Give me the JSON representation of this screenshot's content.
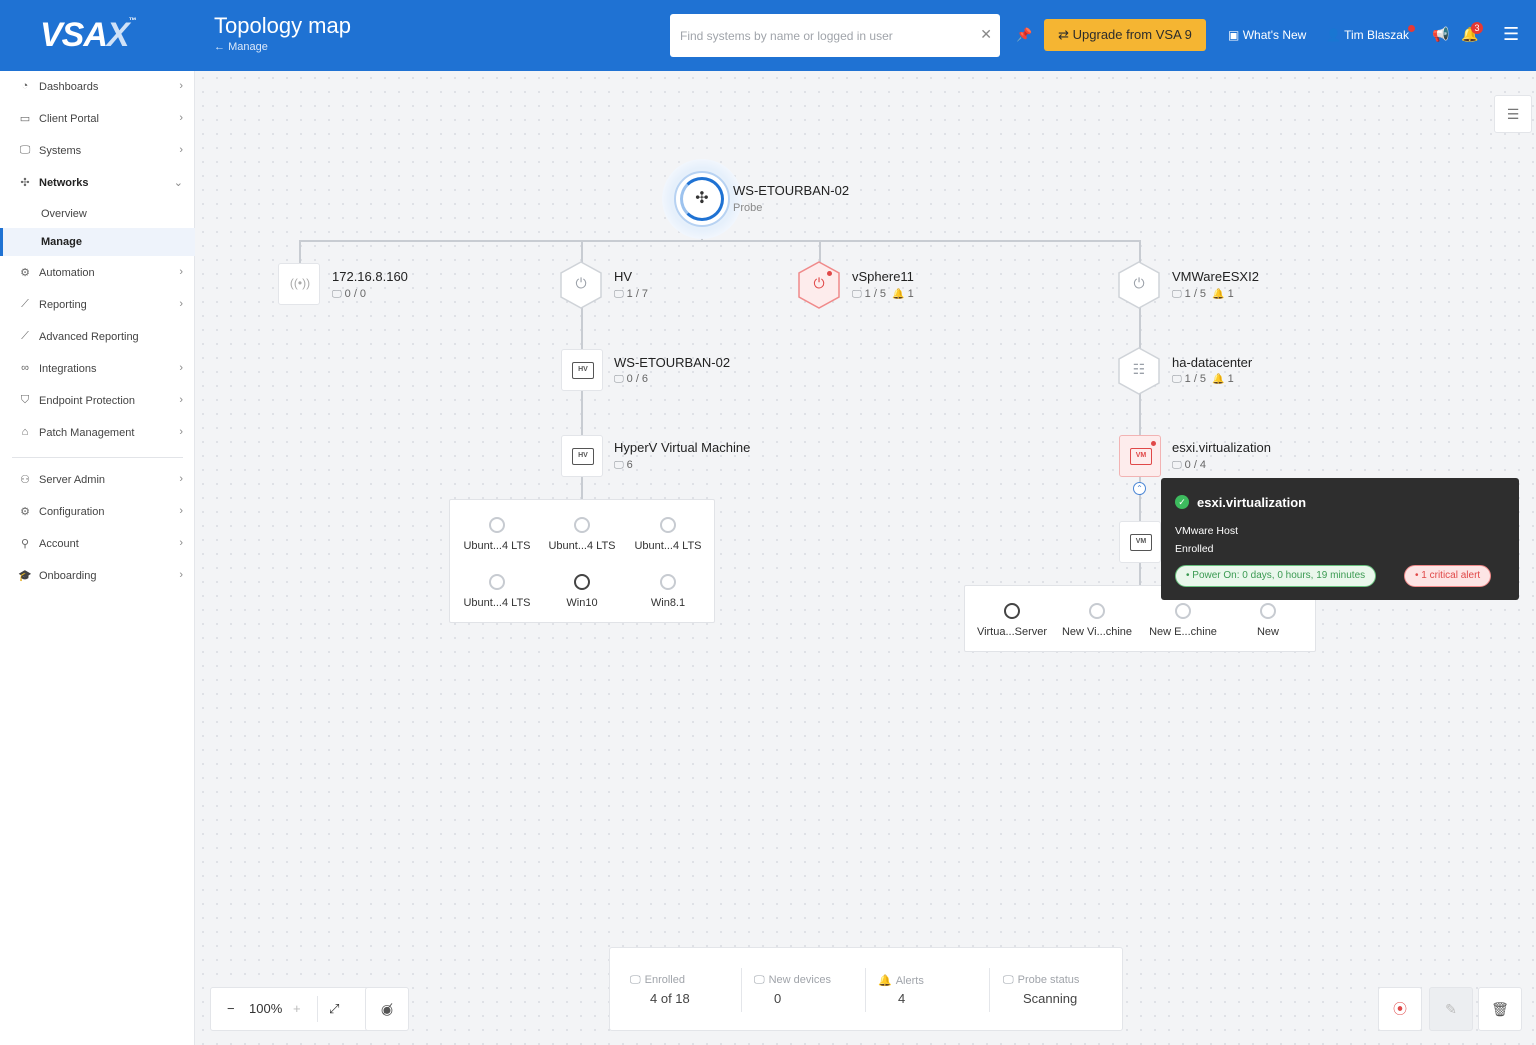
{
  "header": {
    "logo": "VSA",
    "logo_x": "X",
    "logo_tm": "™",
    "title": "Topology map",
    "breadcrumb": "Manage",
    "search_placeholder": "Find systems by name or logged in user",
    "upgrade_label": "Upgrade from VSA 9",
    "whats_new": "What's New",
    "user_name": "Tim Blaszak",
    "notifications_count": "3"
  },
  "sidebar": {
    "items": [
      {
        "label": "Dashboards"
      },
      {
        "label": "Client Portal"
      },
      {
        "label": "Systems"
      },
      {
        "label": "Networks"
      },
      {
        "label": "Automation"
      },
      {
        "label": "Reporting"
      },
      {
        "label": "Advanced Reporting"
      },
      {
        "label": "Integrations"
      },
      {
        "label": "Endpoint Protection"
      },
      {
        "label": "Patch Management"
      },
      {
        "label": "Server Admin"
      },
      {
        "label": "Configuration"
      },
      {
        "label": "Account"
      },
      {
        "label": "Onboarding"
      }
    ],
    "sub_items": [
      {
        "label": "Overview"
      },
      {
        "label": "Manage"
      }
    ]
  },
  "topology": {
    "probe": {
      "name": "WS-ETOURBAN-02",
      "role": "Probe"
    },
    "nodes": {
      "ip": {
        "name": "172.16.8.160",
        "count": "0 / 0"
      },
      "hv": {
        "name": "HV",
        "count": "1 / 7"
      },
      "vsphere": {
        "name": "vSphere11",
        "count": "1 / 5",
        "alerts": "1"
      },
      "vmware": {
        "name": "VMWareESXI2",
        "count": "1 / 5",
        "alerts": "1"
      },
      "ws": {
        "name": "WS-ETOURBAN-02",
        "count": "0 / 6",
        "chip": "HV"
      },
      "hyperv": {
        "name": "HyperV Virtual Machine",
        "count": "6",
        "chip": "HV"
      },
      "datacenter": {
        "name": "ha-datacenter",
        "count": "1 / 5",
        "alerts": "1"
      },
      "esxi": {
        "name": "esxi.virtualization",
        "count": "0 / 4",
        "chip": "VM"
      },
      "vmhost": {
        "chip": "VM"
      }
    },
    "hyperv_vms": [
      "Ubunt...4 LTS",
      "Ubunt...4 LTS",
      "Ubunt...4 LTS",
      "Ubunt...4 LTS",
      "Win10",
      "Win8.1"
    ],
    "esxi_vms": [
      "Virtua...Server",
      "New Vi...chine",
      "New E...chine",
      "New"
    ]
  },
  "tooltip": {
    "title": "esxi.virtualization",
    "type": "VMware Host",
    "status": "Enrolled",
    "power": "Power On: 0 days, 0 hours, 19 minutes",
    "alert": "1 critical alert"
  },
  "zoom": {
    "level": "100%"
  },
  "stats": {
    "enrolled_label": "Enrolled",
    "enrolled_value": "4 of 18",
    "new_label": "New devices",
    "new_value": "0",
    "alerts_label": "Alerts",
    "alerts_value": "4",
    "probe_label": "Probe status",
    "probe_value": "Scanning"
  },
  "colors": {
    "header": "#1f72d3",
    "upgrade": "#f5b532",
    "alert": "#e04848",
    "ok": "#3dbb5e"
  }
}
